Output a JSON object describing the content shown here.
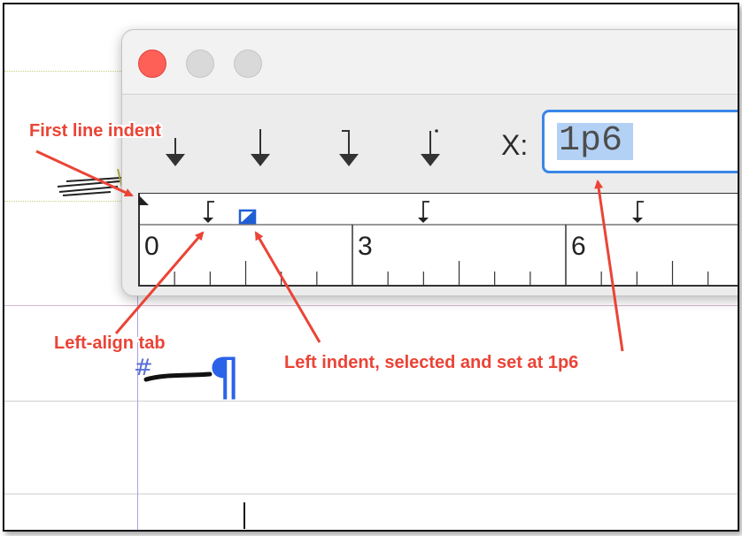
{
  "toolbar": {
    "tab_buttons": [
      {
        "icon": "left-justified-tab-icon"
      },
      {
        "icon": "center-justified-tab-icon"
      },
      {
        "icon": "right-justified-tab-icon"
      },
      {
        "icon": "align-to-decimal-tab-icon"
      }
    ],
    "x_label": "X:",
    "x_value": "1p6"
  },
  "ruler": {
    "labels": [
      "0",
      "3",
      "6"
    ]
  },
  "document": {
    "hash_mark": "#",
    "pilcrow": "¶"
  },
  "annotations": {
    "first_line_indent": "First line indent",
    "left_align_tab": "Left-align tab",
    "left_indent": "Left indent, selected and set at 1p6"
  },
  "colors": {
    "annotation": "#ea4436",
    "selection": "#b3d1f5",
    "focus_ring": "#3a86e8",
    "close_button": "#fe5f57"
  }
}
